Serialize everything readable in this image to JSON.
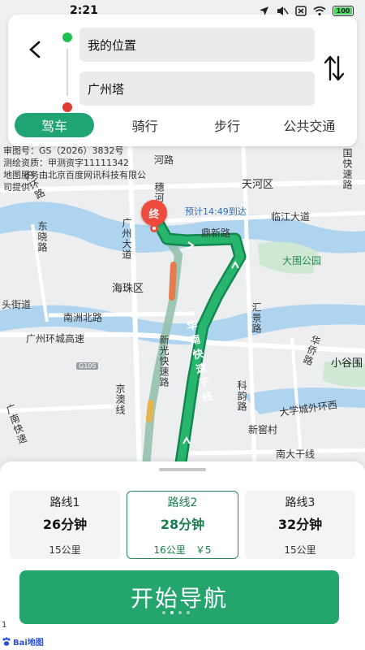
{
  "status_bar": {
    "time": "2:21",
    "battery": "100",
    "icons": [
      "location-arrow-icon",
      "mute-icon",
      "sim-off-icon",
      "wifi-icon",
      "battery-icon"
    ]
  },
  "search": {
    "back_icon": "back-arrow-icon",
    "start_value": "我的位置",
    "end_value": "广州塔",
    "swap_icon": "swap-icon"
  },
  "tabs": [
    {
      "label": "驾车",
      "active": true
    },
    {
      "label": "骑行",
      "active": false
    },
    {
      "label": "步行",
      "active": false
    },
    {
      "label": "公共交通",
      "active": false
    }
  ],
  "map": {
    "copyright_lines": [
      "审图号：GS（2026）3832号",
      "测绘资质：甲测资字11111342",
      "地图服务由北京百度网讯科技有限公",
      "司提供"
    ],
    "end_marker": "终",
    "eta": "预计14:49到达",
    "labels": {
      "tianhe": "天河区",
      "haizhu": "海珠区",
      "linjiang": "临江大道",
      "dingxin": "鼎新路",
      "datong": "大围公园",
      "nanzhou": "南洲北路",
      "guangzhou_huancheng": "广州环城高速",
      "dongxiao": "东晓路",
      "neihuan": "内环路",
      "heguanglu": "河路",
      "tou": "头街道",
      "xinjiao": "新窖村",
      "xiaogu": "小谷围",
      "daxuecheng": "大学城外环西",
      "nanda": "南大干线",
      "guangzhou_dadao": "广州大道",
      "xinguang": "新光快速路",
      "jingao": "京澳线",
      "guangnan": "广南快速",
      "kecheng": "科韵路",
      "huijing": "汇景路",
      "huaqiao": "华侨路",
      "guoqiao": "国快速路",
      "suihe": "穗河路",
      "g105": "G105"
    },
    "highway_label": "华南快速干线"
  },
  "routes": [
    {
      "name": "路线1",
      "time": "26分钟",
      "detail": "15公里",
      "selected": false
    },
    {
      "name": "路线2",
      "time": "28分钟",
      "detail": "16公里　￥5",
      "selected": true
    },
    {
      "name": "路线3",
      "time": "32分钟",
      "detail": "15公里",
      "selected": false
    }
  ],
  "start_button": "开始导航",
  "baidu_logo": "Bai地图",
  "scale": "1"
}
